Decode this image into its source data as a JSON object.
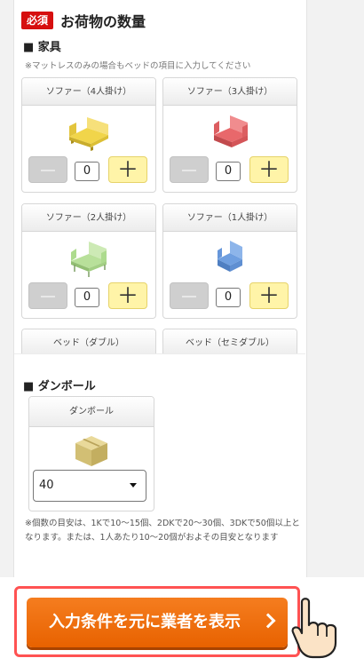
{
  "header": {
    "badge": "必須",
    "title": "お荷物の数量"
  },
  "furniture": {
    "heading": "■ 家具",
    "note": "※マットレスのみの場合もベッドの項目に入力してください",
    "items": [
      {
        "label": "ソファー（4人掛け）",
        "qty": "0",
        "icon": "yellow-sofa-icon",
        "color": "#f1d54a"
      },
      {
        "label": "ソファー（3人掛け）",
        "qty": "0",
        "icon": "red-sofa-icon",
        "color": "#e8686b"
      },
      {
        "label": "ソファー（2人掛け）",
        "qty": "0",
        "icon": "green-sofa-icon",
        "color": "#b8e09a"
      },
      {
        "label": "ソファー（1人掛け）",
        "qty": "0",
        "icon": "blue-sofa-icon",
        "color": "#6f9fe0"
      },
      {
        "label": "ベッド（ダブル）"
      },
      {
        "label": "ベッド（セミダブル）"
      }
    ],
    "plus_symbol": "＋"
  },
  "cardboard": {
    "heading": "■ ダンボール",
    "label": "ダンボール",
    "icon": "cardboard-box-icon",
    "selected": "40",
    "note": "※個数の目安は、1Kで10〜15個、2DKで20〜30個、3DKで50個以上となります。または、1人あたり10〜20個がおよその目安となります"
  },
  "cta": {
    "label": "入力条件を元に業者を表示",
    "color": "#ef6f0a",
    "outline_color": "#ff5252"
  },
  "colors": {
    "badge": "#d60f0f",
    "plus_bg": "#fff4a8",
    "minus_bg": "#cfcfcf"
  }
}
